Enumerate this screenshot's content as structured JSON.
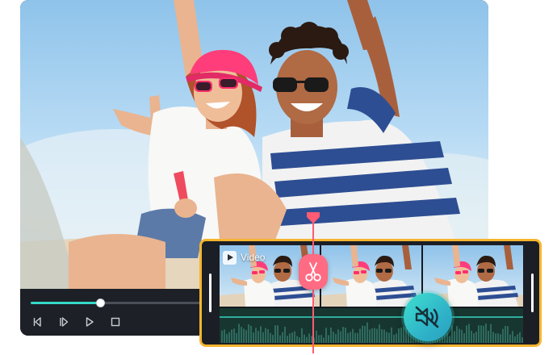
{
  "timeline": {
    "video_track_label": "Video",
    "video_track_icon": "play-icon",
    "accent_color": "#f6b52f",
    "cut_tool_icon": "scissors-icon",
    "mute_icon": "speaker-muted-icon"
  },
  "player": {
    "progress": 0.41,
    "progress_color": "#35d8c9",
    "controls": [
      {
        "name": "previous-frame-icon"
      },
      {
        "name": "next-frame-icon"
      },
      {
        "name": "play-icon"
      },
      {
        "name": "stop-icon"
      }
    ]
  }
}
